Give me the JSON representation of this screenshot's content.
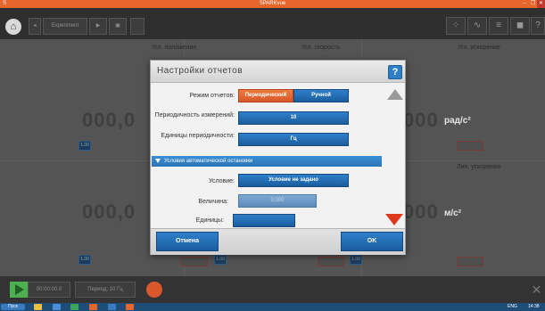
{
  "window": {
    "title": "SPARKvue",
    "minimize_glyph": "–",
    "maximize_glyph": "❐",
    "close_glyph": "✕"
  },
  "toolbar": {
    "home_icon": "home-icon",
    "experiment_label": "Experiment"
  },
  "panels": {
    "angle_position": {
      "label": "Угл. положение",
      "value": "000,0"
    },
    "angular_velocity": {
      "label": "Угл. скорость"
    },
    "angular_acceleration": {
      "label": "Угл. ускорение",
      "value": "000",
      "unit": "рад/с²"
    },
    "linear_acceleration": {
      "label": "Лин. ускорение",
      "value": "000",
      "unit": "м/с²"
    },
    "lower_left": {
      "value": "000,0"
    }
  },
  "bottombar": {
    "time": "00:00:00.0",
    "period": "Период: 10 Гц"
  },
  "dialog": {
    "title": "Настройки отчетов",
    "help_label": "?",
    "report_mode_label": "Режим отчетов:",
    "mode_periodic": "Периодический",
    "mode_manual": "Ручной",
    "periodicity_label": "Периодичность измерений:",
    "periodicity_value": "10",
    "units_label": "Единицы периодичности:",
    "units_value": "Гц",
    "auto_stop_section": "Условия автоматической остановки",
    "condition_label": "Условие:",
    "condition_value": "Условие не задано",
    "magnitude_label": "Величина:",
    "magnitude_value": "0,000",
    "units2_label": "Единицы:",
    "cancel_label": "Отмена",
    "ok_label": "OK"
  },
  "taskbar": {
    "start_label": "Пуск",
    "lang": "ENG",
    "clock": "14:38"
  },
  "colors": {
    "accent_orange": "#e8662c",
    "accent_blue": "#2b74b8",
    "scroll_down_red": "#e03a1e"
  }
}
